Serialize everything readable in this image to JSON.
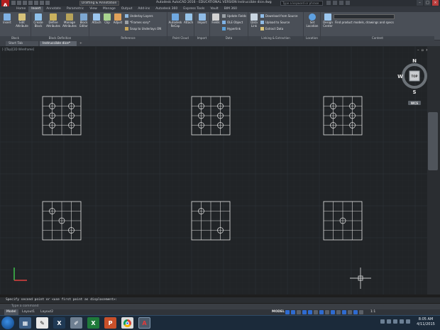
{
  "titlebar": {
    "app_letter": "A",
    "workspace": "Drafting & Annotation",
    "window_title": "Autodesk AutoCAD 2016 - EDUCATIONAL VERSION   Instruccible dice.dwg",
    "search_placeholder": "Type a keyword or phrase"
  },
  "ribbon_tabs": [
    {
      "label": "Home",
      "active": false
    },
    {
      "label": "Insert",
      "active": true
    },
    {
      "label": "Annotate",
      "active": false
    },
    {
      "label": "Parametric",
      "active": false
    },
    {
      "label": "View",
      "active": false
    },
    {
      "label": "Manage",
      "active": false
    },
    {
      "label": "Output",
      "active": false
    },
    {
      "label": "Add-ins",
      "active": false
    },
    {
      "label": "Autodesk 360",
      "active": false
    },
    {
      "label": "Express Tools",
      "active": false
    },
    {
      "label": "Vault",
      "active": false
    },
    {
      "label": "BIM 360",
      "active": false
    }
  ],
  "ribbon": {
    "block": {
      "insert": "Insert",
      "edit_attribute": "Edit Attribute",
      "panel": "Block"
    },
    "block_def": {
      "create": "Create Block",
      "define": "Define Attributes",
      "manage": "Manage Attributes",
      "editor": "Block Editor",
      "panel": "Block Definition"
    },
    "reference": {
      "attach": "Attach",
      "clip": "Clip",
      "adjust": "Adjust",
      "underlay": "Underlay Layers",
      "frames": "*Frames vary*",
      "snap": "Snap to Underlays ON",
      "panel": "Reference"
    },
    "pointcloud": {
      "recap": "Autodesk ReCap",
      "attach": "Attach",
      "panel": "Point Cloud"
    },
    "import": {
      "import": "Import",
      "panel": "Import"
    },
    "data": {
      "fields": "Fields",
      "update": "Update Fields",
      "ole": "OLE Object",
      "hyperlink": "Hyperlink",
      "panel": "Data"
    },
    "linking": {
      "data_link": "Data Link",
      "download": "Download from Source",
      "upload": "Upload to Source",
      "extract": "Extract Data",
      "panel": "Linking & Extraction"
    },
    "location": {
      "set": "Set Location",
      "panel": "Location"
    },
    "content": {
      "design_center": "Design Center",
      "fdi": "Find product models, drawings and specs",
      "panel": "Content"
    }
  },
  "doc_tabs": [
    {
      "label": "Start Tab",
      "active": false
    },
    {
      "label": "Instruccible dice*",
      "active": true
    },
    {
      "label": "+",
      "active": false
    }
  ],
  "viewport": {
    "label": "[-][Top][2D Wireframe]"
  },
  "viewcube": {
    "n": "N",
    "s": "S",
    "e": "E",
    "w": "W",
    "top": "TOP",
    "wcs": "WCS"
  },
  "command": {
    "history": "Specify second point or <use first point as displacement>:",
    "prompt": "Type a command"
  },
  "layout_tabs": [
    {
      "label": "Model",
      "active": true
    },
    {
      "label": "Layout1",
      "active": false
    },
    {
      "label": "Layout2",
      "active": false
    }
  ],
  "status": {
    "model": "MODEL",
    "scale": "1:1"
  },
  "clock": {
    "time": "8:05 AM",
    "date": "4/11/2015"
  }
}
